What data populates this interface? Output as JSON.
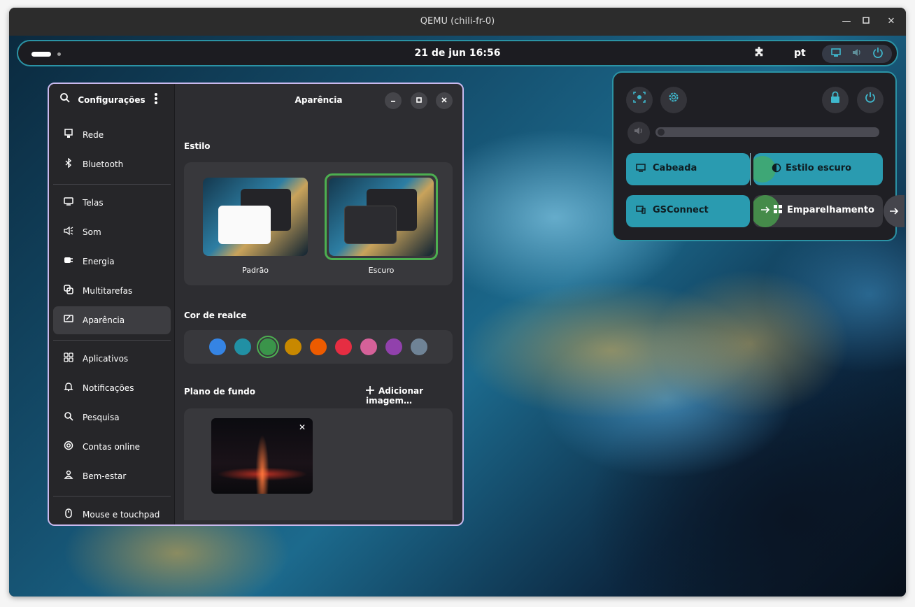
{
  "window": {
    "title": "QEMU (chili-fr-0)",
    "minimize": "—",
    "maximize": "▫",
    "close": "✕"
  },
  "topbar": {
    "clock": "21 de jun  16:56",
    "lang": "pt"
  },
  "settings": {
    "sidebar_title": "Configurações",
    "items": [
      "Rede",
      "Bluetooth",
      "Telas",
      "Som",
      "Energia",
      "Multitarefas",
      "Aparência",
      "Aplicativos",
      "Notificações",
      "Pesquisa",
      "Contas online",
      "Bem-estar",
      "Mouse e touchpad"
    ],
    "selected": "Aparência",
    "page_title": "Aparência",
    "style_label": "Estilo",
    "style_default": "Padrão",
    "style_dark": "Escuro",
    "accent_label": "Cor de realce",
    "accent_colors": [
      "#3584e4",
      "#2190a4",
      "#3a944a",
      "#c88800",
      "#ed5b00",
      "#e62d42",
      "#d56199",
      "#9141ac",
      "#6f8396"
    ],
    "accent_selected": "#3a944a",
    "background_label": "Plano de fundo",
    "add_image": "Adicionar imagem…"
  },
  "quick_settings": {
    "toggles": [
      {
        "label": "Cabeada",
        "active": true
      },
      {
        "label": "Estilo escuro",
        "active": true
      },
      {
        "label": "GSConnect",
        "active": true
      },
      {
        "label": "Emparelhamento",
        "active": false
      }
    ],
    "volume": 0.0
  },
  "colors": {
    "accent": "#2b93a5",
    "toggle_on": "#2a9bb0",
    "toggle_off": "#38383e",
    "panel": "#1f1f24",
    "focus_green": "#4caf50"
  }
}
